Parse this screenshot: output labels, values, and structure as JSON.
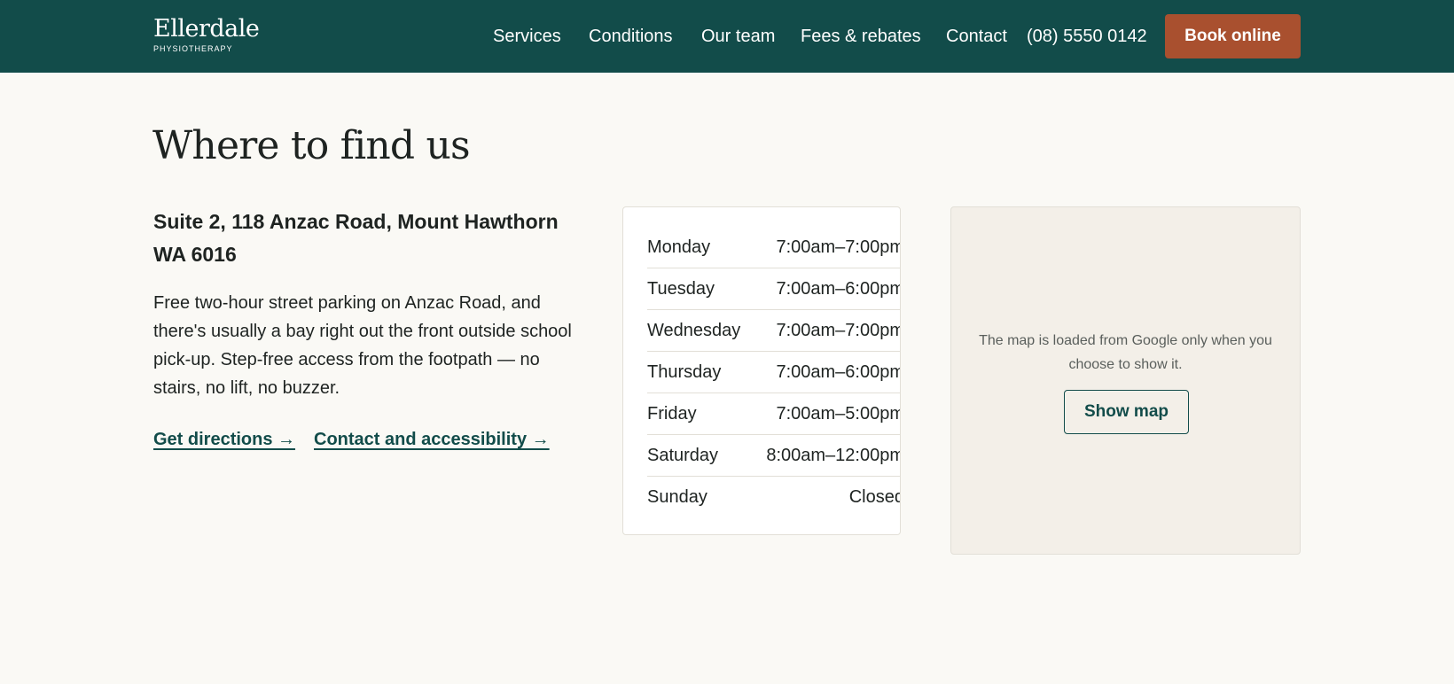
{
  "header": {
    "logo_name": "Ellerdale",
    "logo_sub": "PHYSIOTHERAPY",
    "nav": [
      {
        "label": "Services"
      },
      {
        "label": "Conditions"
      },
      {
        "label": "Our team"
      },
      {
        "label": "Fees & rebates"
      },
      {
        "label": "Contact"
      }
    ],
    "phone": "(08) 5550 0142",
    "book_label": "Book online"
  },
  "main": {
    "title": "Where to find us",
    "address": "Suite 2, 118 Anzac Road, Mount Hawthorn WA 6016",
    "parking_text": "Free two-hour street parking on Anzac Road, and there's usually a bay right out the front outside school pick-up. Step-free access from the footpath — no stairs, no lift, no buzzer.",
    "links": [
      {
        "label": "Get directions →"
      },
      {
        "label": "Contact and accessibility →"
      }
    ]
  },
  "hours": [
    {
      "day": "Monday",
      "time": "7:00am–7:00pm"
    },
    {
      "day": "Tuesday",
      "time": "7:00am–6:00pm"
    },
    {
      "day": "Wednesday",
      "time": "7:00am–7:00pm"
    },
    {
      "day": "Thursday",
      "time": "7:00am–6:00pm"
    },
    {
      "day": "Friday",
      "time": "7:00am–5:00pm"
    },
    {
      "day": "Saturday",
      "time": "8:00am–12:00pm"
    },
    {
      "day": "Sunday",
      "time": "Closed"
    }
  ],
  "map": {
    "note": "The map is loaded from Google only when you choose to show it.",
    "button_label": "Show map"
  },
  "colors": {
    "header_bg": "#124c4a",
    "accent": "#a9502f",
    "page_bg": "#faf9f5"
  }
}
